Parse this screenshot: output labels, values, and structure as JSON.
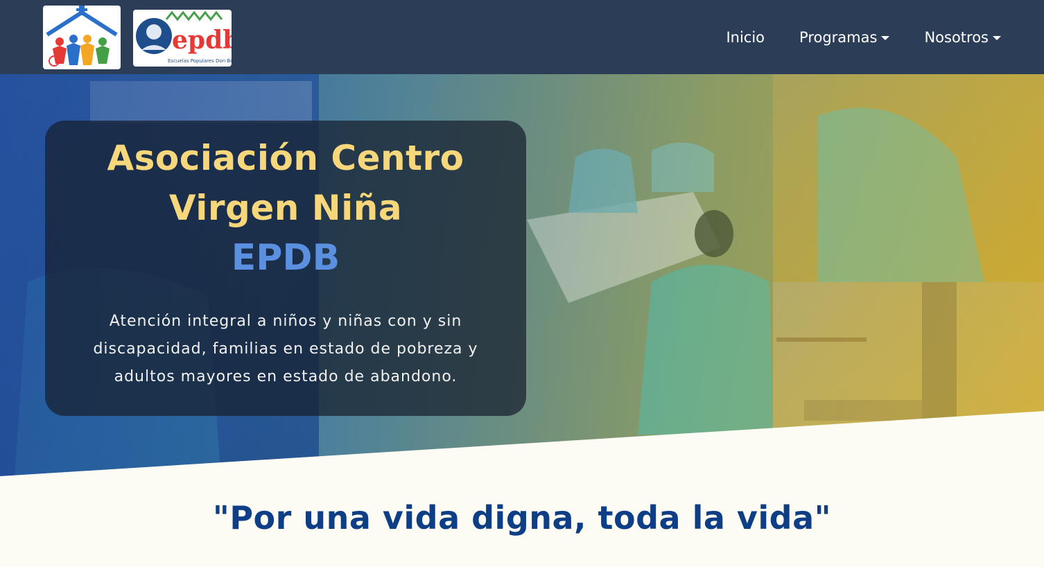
{
  "nav": {
    "logo_main_alt": "Asociación Centro Virgen Niña logo",
    "logo_epdb_text": "epdb",
    "logo_epdb_caption": "Escuelas Populares Don Bosco",
    "items": [
      {
        "label": "Inicio",
        "dropdown": false
      },
      {
        "label": "Programas",
        "dropdown": true
      },
      {
        "label": "Nosotros",
        "dropdown": true
      }
    ]
  },
  "hero": {
    "title_line1": "Asociación Centro",
    "title_line2": "Virgen Niña",
    "subtitle": "EPDB",
    "description": "Atención integral a niños y niñas con y sin discapacidad, familias en estado de pobreza y adultos mayores en estado de abandono."
  },
  "motto": {
    "text": "\"Por una vida digna, toda la vida\""
  },
  "colors": {
    "navbar": "#2c3e57",
    "title_gold": "#f7d77c",
    "subtitle_blue": "#5b8fe0",
    "motto_blue": "#0e3f86",
    "page_background": "#fdfcf4"
  }
}
